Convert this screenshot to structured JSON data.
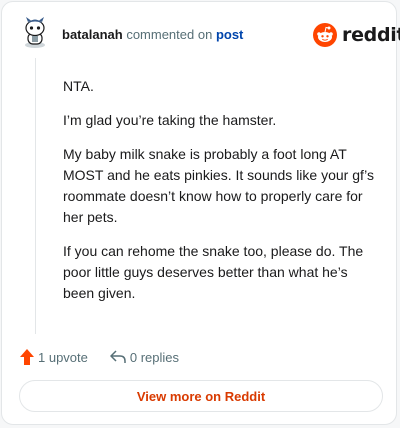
{
  "header": {
    "username": "batalanah",
    "action_text": "commented on",
    "post_link_text": "post"
  },
  "brand": {
    "wordmark": "reddit",
    "logo_icon": "reddit-snoo-icon",
    "accent_color": "#ff4500"
  },
  "comment": {
    "paragraphs": [
      "NTA.",
      "I’m glad you’re taking the hamster.",
      "My baby milk snake is probably a foot long AT MOST and he eats pinkies. It sounds like your gf’s roommate doesn’t know how to properly care for her pets.",
      "If you can rehome the snake too, please do. The poor little guys deserves better than what he’s been given."
    ]
  },
  "actions": {
    "upvote_label": "1 upvote",
    "upvote_icon": "upvote-arrow-icon",
    "upvote_color": "#ff4500",
    "replies_label": "0 replies",
    "replies_icon": "reply-arrow-icon"
  },
  "footer": {
    "view_button_label": "View more on Reddit",
    "view_button_color": "#d93a00"
  }
}
